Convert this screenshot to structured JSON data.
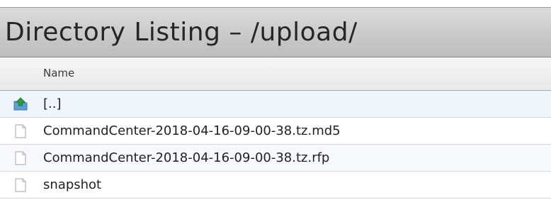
{
  "title": "Directory Listing – /upload/",
  "columns": {
    "name": "Name"
  },
  "entries": [
    {
      "label": "[..]",
      "icon": "parent-folder-icon"
    },
    {
      "label": "CommandCenter-2018-04-16-09-00-38.tz.md5",
      "icon": "file-icon"
    },
    {
      "label": "CommandCenter-2018-04-16-09-00-38.tz.rfp",
      "icon": "file-icon"
    },
    {
      "label": "snapshot",
      "icon": "file-icon"
    }
  ],
  "colors": {
    "title_bar": "#c8c8c8",
    "parent_icon": "#2e9e3a",
    "file_icon_border": "#b5b5b5"
  }
}
